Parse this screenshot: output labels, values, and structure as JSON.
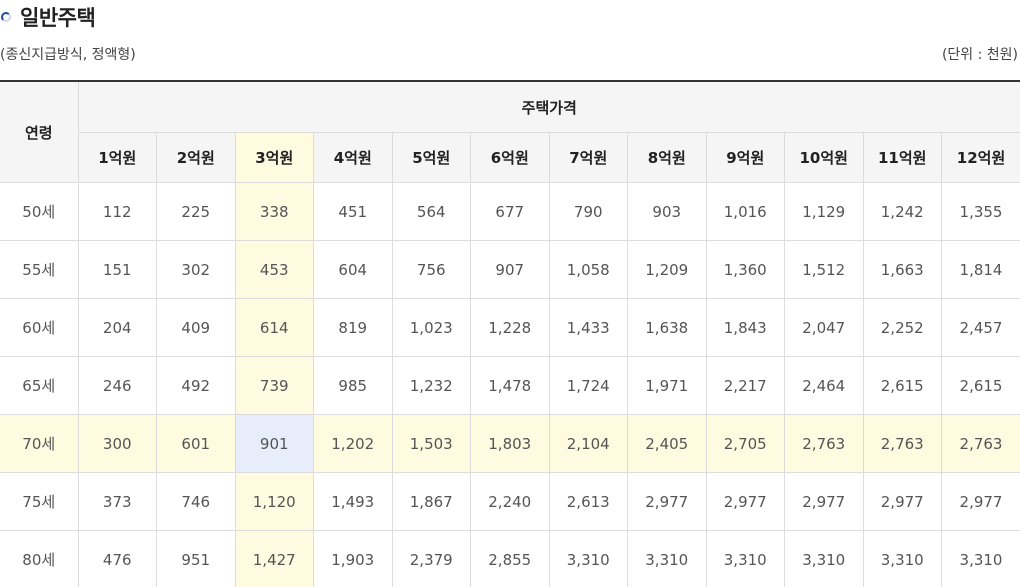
{
  "header": {
    "title": "일반주택",
    "subtitle": "(종신지급방식, 정액형)",
    "unit": "(단위 : 천원)"
  },
  "table": {
    "age_header": "연령",
    "group_header": "주택가격",
    "columns": [
      "1억원",
      "2억원",
      "3억원",
      "4억원",
      "5억원",
      "6억원",
      "7억원",
      "8억원",
      "9억원",
      "10억원",
      "11억원",
      "12억원"
    ],
    "highlight_column_index": 2,
    "highlight_row_index": 4,
    "rows": [
      {
        "age": "50세",
        "values": [
          "112",
          "225",
          "338",
          "451",
          "564",
          "677",
          "790",
          "903",
          "1,016",
          "1,129",
          "1,242",
          "1,355"
        ]
      },
      {
        "age": "55세",
        "values": [
          "151",
          "302",
          "453",
          "604",
          "756",
          "907",
          "1,058",
          "1,209",
          "1,360",
          "1,512",
          "1,663",
          "1,814"
        ]
      },
      {
        "age": "60세",
        "values": [
          "204",
          "409",
          "614",
          "819",
          "1,023",
          "1,228",
          "1,433",
          "1,638",
          "1,843",
          "2,047",
          "2,252",
          "2,457"
        ]
      },
      {
        "age": "65세",
        "values": [
          "246",
          "492",
          "739",
          "985",
          "1,232",
          "1,478",
          "1,724",
          "1,971",
          "2,217",
          "2,464",
          "2,615",
          "2,615"
        ]
      },
      {
        "age": "70세",
        "values": [
          "300",
          "601",
          "901",
          "1,202",
          "1,503",
          "1,803",
          "2,104",
          "2,405",
          "2,705",
          "2,763",
          "2,763",
          "2,763"
        ]
      },
      {
        "age": "75세",
        "values": [
          "373",
          "746",
          "1,120",
          "1,493",
          "1,867",
          "2,240",
          "2,613",
          "2,977",
          "2,977",
          "2,977",
          "2,977",
          "2,977"
        ]
      },
      {
        "age": "80세",
        "values": [
          "476",
          "951",
          "1,427",
          "1,903",
          "2,379",
          "2,855",
          "3,310",
          "3,310",
          "3,310",
          "3,310",
          "3,310",
          "3,310"
        ]
      }
    ]
  },
  "colors": {
    "highlight_yellow": "#fefbe0",
    "highlight_blue": "#e7edfb",
    "header_bg": "#f5f5f5",
    "top_border": "#333333"
  }
}
